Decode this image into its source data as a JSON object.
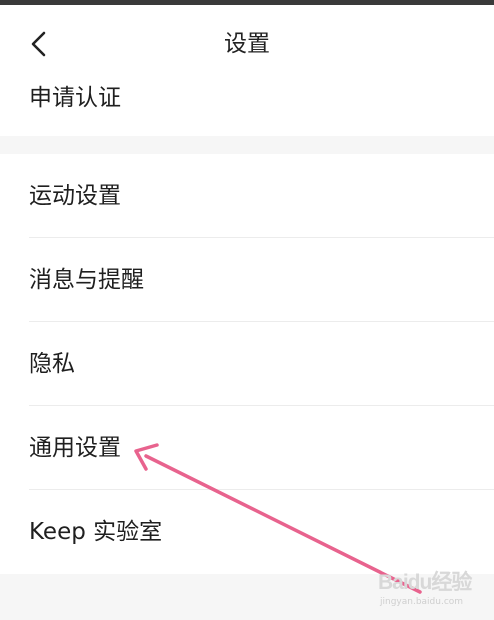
{
  "header": {
    "title": "设置"
  },
  "items": [
    {
      "label": "申请认证"
    },
    {
      "label": "运动设置"
    },
    {
      "label": "消息与提醒"
    },
    {
      "label": "隐私"
    },
    {
      "label": "通用设置"
    },
    {
      "label": "Keep 实验室"
    }
  ],
  "annotation": {
    "arrow_color": "#e8638e",
    "points_to": "通用设置"
  },
  "watermark": {
    "main": "Baidu经验",
    "sub": "jingyan.baidu.com"
  },
  "colors": {
    "background": "#ffffff",
    "section_gap": "#f6f6f6",
    "divider": "#ececec",
    "text": "#1f1f1f",
    "status_bar": "#3a3a3a"
  },
  "icons": {
    "back": "chevron-left-icon"
  }
}
